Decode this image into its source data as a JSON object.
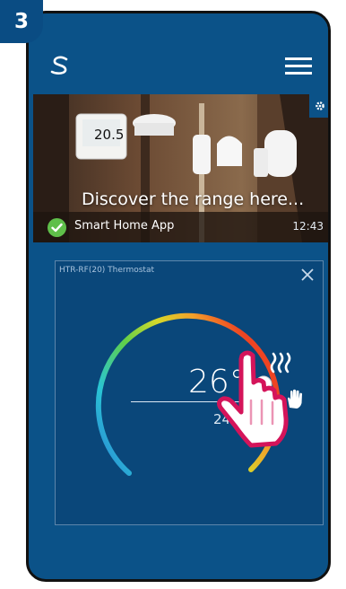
{
  "step_number": "3",
  "app": {
    "icons": {
      "logo": "salus-logo-icon",
      "menu": "hamburger-menu-icon",
      "settings": "gear-icon"
    }
  },
  "banner": {
    "title": "Discover the range here...",
    "app_label": "Smart Home App",
    "time": "12:43",
    "thermostat_display": "20.5"
  },
  "thermostat_card": {
    "title": "HTR-RF(20) Thermostat",
    "current_temp": "26°",
    "set_temp": "24°",
    "dial_gradient": [
      "#2b7fd6",
      "#29c4d4",
      "#5fcf4a",
      "#d6d92a",
      "#f2a12a",
      "#ee4422"
    ],
    "icons": {
      "close": "close-icon",
      "heating": "heating-waves-icon",
      "manual": "hand-icon"
    }
  },
  "pointer": {
    "icon": "tap-hand-pointer-icon"
  },
  "colors": {
    "app_blue": "#0b5288",
    "card_blue": "#0a477a",
    "pointer_pink": "#d4145a"
  }
}
